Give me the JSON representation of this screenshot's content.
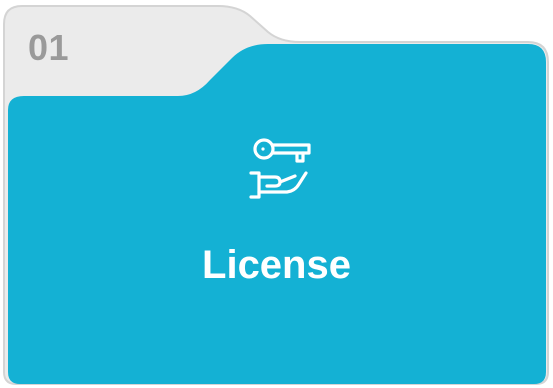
{
  "card": {
    "number": "01",
    "title": "License",
    "icon": "key-in-hand-icon"
  },
  "colors": {
    "folder_back": "#ebebeb",
    "folder_back_border": "#d4d4d4",
    "folder_front": "#14b1d4",
    "number_text": "#9a9a9a",
    "title_text": "#ffffff"
  }
}
